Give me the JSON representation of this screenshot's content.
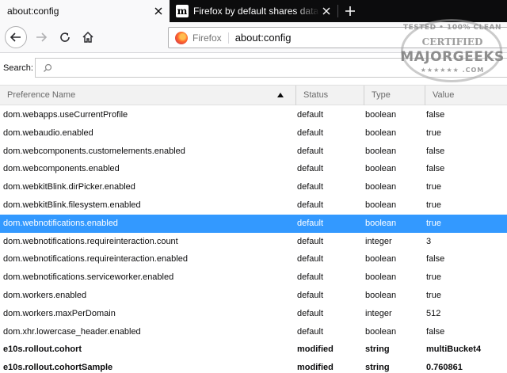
{
  "tabs": [
    {
      "title": "about:config",
      "active": true
    },
    {
      "title": "Firefox by default shares data to",
      "active": false
    }
  ],
  "nav": {
    "identity_label": "Firefox",
    "url": "about:config"
  },
  "search": {
    "label": "Search:",
    "value": ""
  },
  "table": {
    "columns": [
      "Preference Name",
      "Status",
      "Type",
      "Value"
    ],
    "sort": {
      "column": "Preference Name",
      "direction": "ascending"
    },
    "rows": [
      {
        "name": "dom.webapps.useCurrentProfile",
        "status": "default",
        "type": "boolean",
        "value": "false"
      },
      {
        "name": "dom.webaudio.enabled",
        "status": "default",
        "type": "boolean",
        "value": "true"
      },
      {
        "name": "dom.webcomponents.customelements.enabled",
        "status": "default",
        "type": "boolean",
        "value": "false"
      },
      {
        "name": "dom.webcomponents.enabled",
        "status": "default",
        "type": "boolean",
        "value": "false"
      },
      {
        "name": "dom.webkitBlink.dirPicker.enabled",
        "status": "default",
        "type": "boolean",
        "value": "true"
      },
      {
        "name": "dom.webkitBlink.filesystem.enabled",
        "status": "default",
        "type": "boolean",
        "value": "true"
      },
      {
        "name": "dom.webnotifications.enabled",
        "status": "default",
        "type": "boolean",
        "value": "true"
      },
      {
        "name": "dom.webnotifications.requireinteraction.count",
        "status": "default",
        "type": "integer",
        "value": "3"
      },
      {
        "name": "dom.webnotifications.requireinteraction.enabled",
        "status": "default",
        "type": "boolean",
        "value": "false"
      },
      {
        "name": "dom.webnotifications.serviceworker.enabled",
        "status": "default",
        "type": "boolean",
        "value": "true"
      },
      {
        "name": "dom.workers.enabled",
        "status": "default",
        "type": "boolean",
        "value": "true"
      },
      {
        "name": "dom.workers.maxPerDomain",
        "status": "default",
        "type": "integer",
        "value": "512"
      },
      {
        "name": "dom.xhr.lowercase_header.enabled",
        "status": "default",
        "type": "boolean",
        "value": "false"
      },
      {
        "name": "e10s.rollout.cohort",
        "status": "modified",
        "type": "string",
        "value": "multiBucket4"
      },
      {
        "name": "e10s.rollout.cohortSample",
        "status": "modified",
        "type": "string",
        "value": "0.760861"
      }
    ],
    "selected_row": "dom.webnotifications.enabled"
  },
  "watermark": {
    "line1": "TESTED • 100% CLEAN",
    "line2": "CERTIFIED",
    "line3": "MAJORGEEKS",
    "line4": "★★★★★★ .COM"
  },
  "colors": {
    "tabstrip": "#0c0c0d",
    "selection": "#3399ff",
    "header_bg": "#f2f2f2"
  }
}
